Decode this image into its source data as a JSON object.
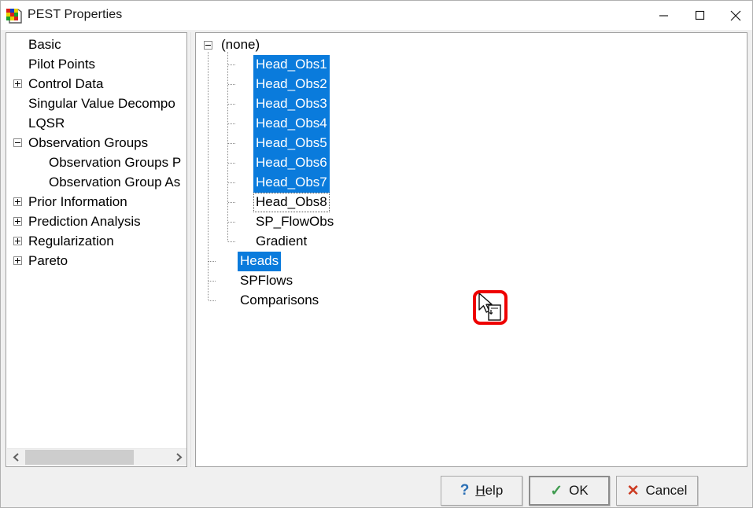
{
  "window": {
    "title": "PEST Properties",
    "icon": "blocks-icon",
    "controls": {
      "minimize": "minimize-icon",
      "maximize": "maximize-icon",
      "close": "close-icon"
    }
  },
  "left_tree": {
    "name": "pest-settings-tree",
    "items": [
      {
        "label": "Basic",
        "level": 1,
        "expander": "none"
      },
      {
        "label": "Pilot Points",
        "level": 1,
        "expander": "none"
      },
      {
        "label": "Control Data",
        "level": 1,
        "expander": "plus"
      },
      {
        "label": "Singular Value Decompo",
        "level": 1,
        "expander": "none"
      },
      {
        "label": "LQSR",
        "level": 1,
        "expander": "none"
      },
      {
        "label": "Observation Groups",
        "level": 1,
        "expander": "minus"
      },
      {
        "label": "Observation Groups P",
        "level": 2,
        "expander": "none"
      },
      {
        "label": "Observation Group As",
        "level": 2,
        "expander": "none"
      },
      {
        "label": "Prior Information",
        "level": 1,
        "expander": "plus"
      },
      {
        "label": "Prediction Analysis",
        "level": 1,
        "expander": "plus"
      },
      {
        "label": "Regularization",
        "level": 1,
        "expander": "plus"
      },
      {
        "label": "Pareto",
        "level": 1,
        "expander": "plus"
      }
    ],
    "scrollbar": {
      "left_arrow": "◀",
      "right_arrow": "▶"
    }
  },
  "right_tree": {
    "name": "observation-groups-tree",
    "root": {
      "label": "(none)",
      "expander": "minus"
    },
    "items": [
      {
        "label": "Head_Obs1",
        "level": 2,
        "selected": true,
        "focused": false
      },
      {
        "label": "Head_Obs2",
        "level": 2,
        "selected": true,
        "focused": false
      },
      {
        "label": "Head_Obs3",
        "level": 2,
        "selected": true,
        "focused": false
      },
      {
        "label": "Head_Obs4",
        "level": 2,
        "selected": true,
        "focused": false
      },
      {
        "label": "Head_Obs5",
        "level": 2,
        "selected": true,
        "focused": false
      },
      {
        "label": "Head_Obs6",
        "level": 2,
        "selected": true,
        "focused": false
      },
      {
        "label": "Head_Obs7",
        "level": 2,
        "selected": true,
        "focused": false
      },
      {
        "label": "Head_Obs8",
        "level": 2,
        "selected": false,
        "focused": true
      },
      {
        "label": "SP_FlowObs",
        "level": 2,
        "selected": false,
        "focused": false
      },
      {
        "label": "Gradient",
        "level": 2,
        "selected": false,
        "focused": false
      },
      {
        "label": "Heads",
        "level": 1,
        "selected": true,
        "focused": false
      },
      {
        "label": "SPFlows",
        "level": 1,
        "selected": false,
        "focused": false
      },
      {
        "label": "Comparisons",
        "level": 1,
        "selected": false,
        "focused": false
      }
    ]
  },
  "annotation": {
    "cursor": "drag-drop-cursor",
    "highlight_color": "#ee0000"
  },
  "buttons": {
    "help": {
      "label": "Help",
      "accel": "H",
      "icon": "question-mark-icon"
    },
    "ok": {
      "label": "OK",
      "icon": "checkmark-icon",
      "default": true
    },
    "cancel": {
      "label": "Cancel",
      "icon": "x-mark-icon"
    }
  },
  "colors": {
    "selection": "#0a7bdc",
    "dialog_bg": "#f0f0f0",
    "panel_bg": "#ffffff",
    "annotation": "#ee0000"
  }
}
